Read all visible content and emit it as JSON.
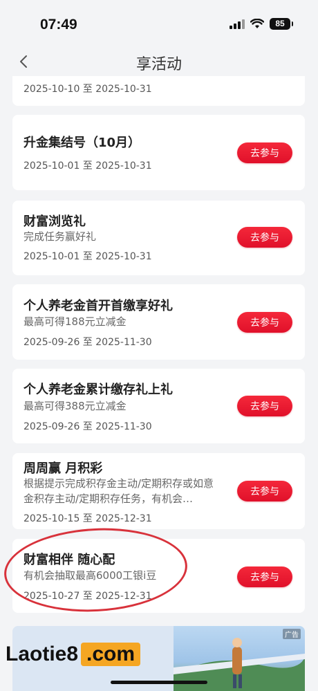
{
  "status_bar": {
    "time": "07:49",
    "battery": "85"
  },
  "nav": {
    "title": "享活动"
  },
  "join_label": "去参与",
  "partial_card": {
    "date": "2025-10-10 至 2025-10-31"
  },
  "cards": [
    {
      "title": "升金集结号（10月）",
      "desc": "",
      "date": "2025-10-01 至 2025-10-31"
    },
    {
      "title": "财富浏览礼",
      "desc": "完成任务赢好礼",
      "date": "2025-10-01 至 2025-10-31"
    },
    {
      "title": "个人养老金首开首缴享好礼",
      "desc": "最高可得188元立减金",
      "date": "2025-09-26 至 2025-11-30"
    },
    {
      "title": "个人养老金累计缴存礼上礼",
      "desc": "最高可得388元立减金",
      "date": "2025-09-26 至 2025-11-30"
    },
    {
      "title": "周周赢 月积彩",
      "desc": "根据提示完成积存金主动/定期积存或如意金积存主动/定期积存任务，有机会…",
      "date": "2025-10-15 至 2025-12-31"
    },
    {
      "title": "财富相伴 随心配",
      "desc": "有机会抽取最高6000工银i豆",
      "date": "2025-10-27 至 2025-12-31"
    }
  ],
  "banner": {
    "ad_tag": "广告"
  },
  "watermark": {
    "part1": "Laotie8",
    "part2": ".com"
  },
  "colors": {
    "accent": "#e8162c",
    "highlight_circle": "#d8323b"
  }
}
